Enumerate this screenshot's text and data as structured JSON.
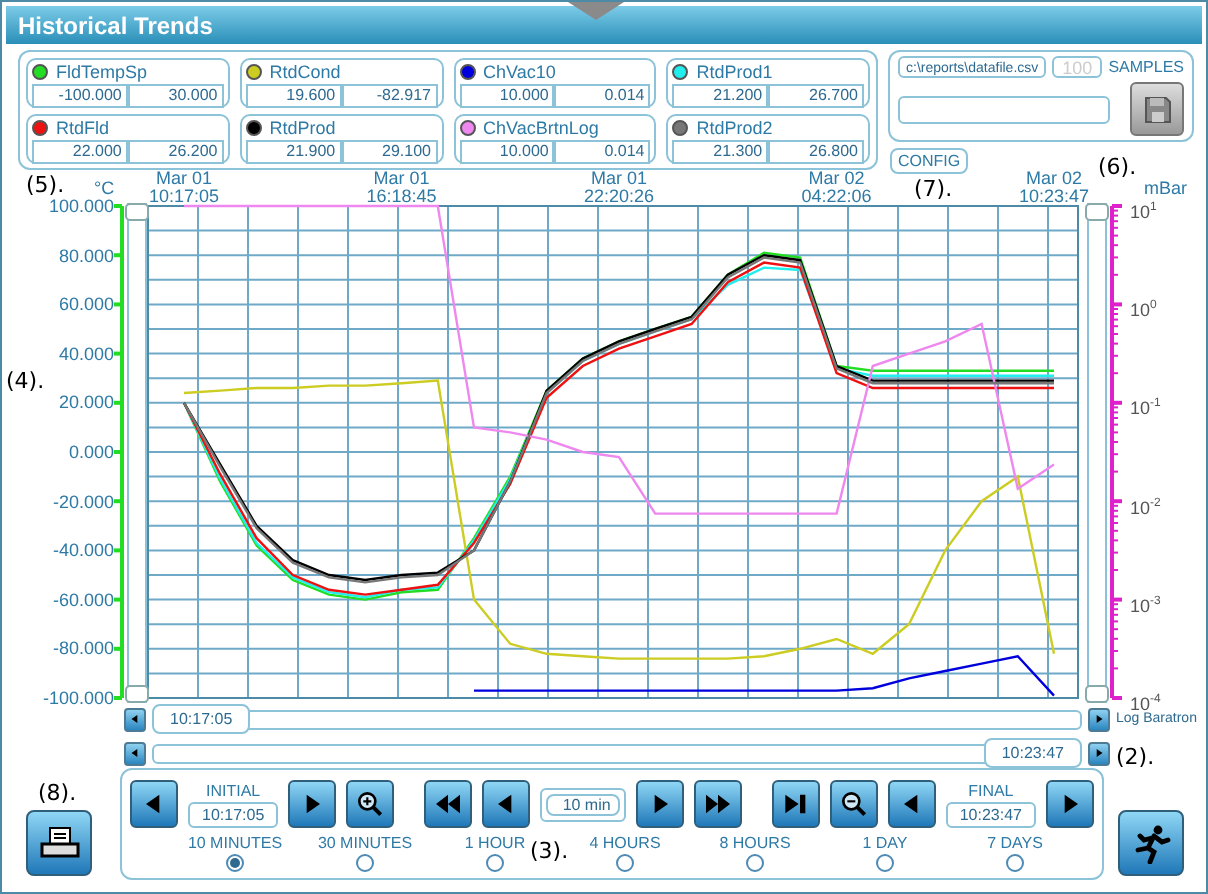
{
  "window": {
    "title": "Historical Trends"
  },
  "channels": [
    {
      "value_1": "-100.000",
      "value_2": "30.000"
    },
    {
      "value_1": "19.600",
      "value_2": "-82.917"
    },
    {
      "value_1": "10.000",
      "value_2": "0.014"
    },
    {
      "value_1": "21.200",
      "value_2": "26.700"
    },
    {
      "value_1": "22.000",
      "value_2": "26.200"
    },
    {
      "value_1": "21.900",
      "value_2": "29.100"
    },
    {
      "value_1": "10.000",
      "value_2": "0.014"
    },
    {
      "value_1": "21.300",
      "value_2": "26.800"
    }
  ],
  "export": {
    "file_path": "c:\\reports\\datafile.csv",
    "samples": {
      "value": "100",
      "disabled": true
    },
    "samples_label": "SAMPLES",
    "save_button": {
      "disabled": true
    }
  },
  "config_button": "CONFIG",
  "callouts": [
    "(6).",
    "(5).",
    "(7).",
    "(4).",
    "(2).",
    "(8).",
    "(3)."
  ],
  "chart": {
    "left_unit": "°C",
    "right_unit": "mBar",
    "right_ticks": [
      "10$^{1}$",
      "10$^{0}$",
      "10$^{-1}$",
      "10$^{-2}$",
      "10$^{-3}$",
      "10$^{-4}$"
    ],
    "chart_data": {
      "type": "line",
      "grid": true,
      "categories": [
        "Mar 01 10:17:05",
        null,
        null,
        null,
        null,
        null,
        "Mar 01 16:18:45",
        null,
        null,
        null,
        null,
        null,
        "Mar 01 22:20:26",
        null,
        null,
        null,
        null,
        null,
        "Mar 02 04:22:06",
        null,
        null,
        null,
        null,
        null,
        "Mar 02 10:23:47"
      ],
      "ylim": [
        -100,
        100
      ],
      "yticks": [
        {
          "value": 100,
          "label": "100.000"
        },
        {
          "value": 80,
          "label": "80.000"
        },
        {
          "value": 60,
          "label": "60.000"
        },
        {
          "value": 40,
          "label": "40.000"
        },
        {
          "value": 20,
          "label": "20.000"
        },
        {
          "value": 0,
          "label": "0.000"
        },
        {
          "value": -20,
          "label": "-20.000"
        },
        {
          "value": -40,
          "label": "-40.000"
        },
        {
          "value": -60,
          "label": "-60.000"
        },
        {
          "value": -80,
          "label": "-80.000"
        },
        {
          "value": -100,
          "label": "-100.000"
        }
      ],
      "series": [
        {
          "name": "FldTempSp",
          "color": "#22dd22",
          "values": [
            20,
            -12,
            -38,
            -52,
            -58,
            -60,
            -57,
            -56,
            -35,
            -10,
            25,
            38,
            45,
            50,
            55,
            72,
            81,
            79,
            35,
            33,
            33,
            33,
            33,
            33,
            33
          ]
        },
        {
          "name": "RtdCond",
          "color": "#cccc22",
          "values": [
            24,
            25,
            26,
            26,
            27,
            27,
            28,
            29,
            -60,
            -78,
            -82,
            -83,
            -84,
            -84,
            -84,
            -84,
            -83,
            -80,
            -76,
            -82,
            -70,
            -40,
            -20,
            -10,
            -82
          ]
        },
        {
          "name": "ChVac10",
          "color": "#0000dd",
          "values": [
            null,
            null,
            null,
            null,
            null,
            null,
            null,
            null,
            -97,
            -97,
            -97,
            -97,
            -97,
            -97,
            -97,
            -97,
            -97,
            -97,
            -97,
            -96,
            -92,
            -89,
            -86,
            -83,
            -99
          ]
        },
        {
          "name": "RtdProd1",
          "color": "#22eeee",
          "values": [
            20,
            -11,
            -37,
            -51,
            -57,
            -59,
            -56,
            -55,
            -36,
            -11,
            24,
            37,
            44,
            49,
            54,
            68,
            75,
            74,
            34,
            31,
            31,
            31,
            31,
            31,
            31
          ]
        },
        {
          "name": "RtdFld",
          "color": "#ee1111",
          "values": [
            20,
            -9,
            -35,
            -50,
            -56,
            -58,
            -56,
            -54,
            -37,
            -13,
            22,
            35,
            42,
            47,
            52,
            69,
            77,
            75,
            32,
            26,
            26,
            26,
            26,
            26,
            26
          ]
        },
        {
          "name": "RtdProd",
          "color": "#000000",
          "values": [
            20,
            -5,
            -30,
            -44,
            -50,
            -52,
            -50,
            -49,
            -40,
            -12,
            25,
            38,
            45,
            50,
            55,
            72,
            80,
            78,
            35,
            29,
            29,
            29,
            29,
            29,
            29
          ]
        },
        {
          "name": "ChVacBrtnLog",
          "color": "#ee88ee",
          "values": [
            100,
            100,
            100,
            100,
            100,
            100,
            100,
            100,
            10,
            8,
            5,
            0,
            -2,
            -25,
            -25,
            -25,
            -25,
            -25,
            -25,
            35,
            40,
            45,
            52,
            -15,
            -5
          ]
        },
        {
          "name": "RtdProd2",
          "color": "#777777",
          "values": [
            20,
            -6,
            -31,
            -45,
            -51,
            -53,
            -51,
            -50,
            -40,
            -12,
            24,
            37,
            44,
            49,
            54,
            71,
            79,
            77,
            34,
            28,
            28,
            28,
            28,
            28,
            28
          ]
        }
      ]
    }
  },
  "timebar": {
    "start": "10:17:05",
    "end": "10:23:47",
    "right_axis_label": "Log Baratron"
  },
  "controls": {
    "initial_label": "INITIAL",
    "initial_time": "10:17:05",
    "span": "10 min",
    "final_label": "FINAL",
    "final_time": "10:23:47",
    "ranges": [
      {
        "label": "10 MINUTES",
        "selected": true
      },
      {
        "label": "30 MINUTES",
        "selected": false
      },
      {
        "label": "1 HOUR",
        "selected": false
      },
      {
        "label": "4 HOURS",
        "selected": false
      },
      {
        "label": "8 HOURS",
        "selected": false
      },
      {
        "label": "1 DAY",
        "selected": false
      },
      {
        "label": "7 DAYS",
        "selected": false
      }
    ]
  }
}
